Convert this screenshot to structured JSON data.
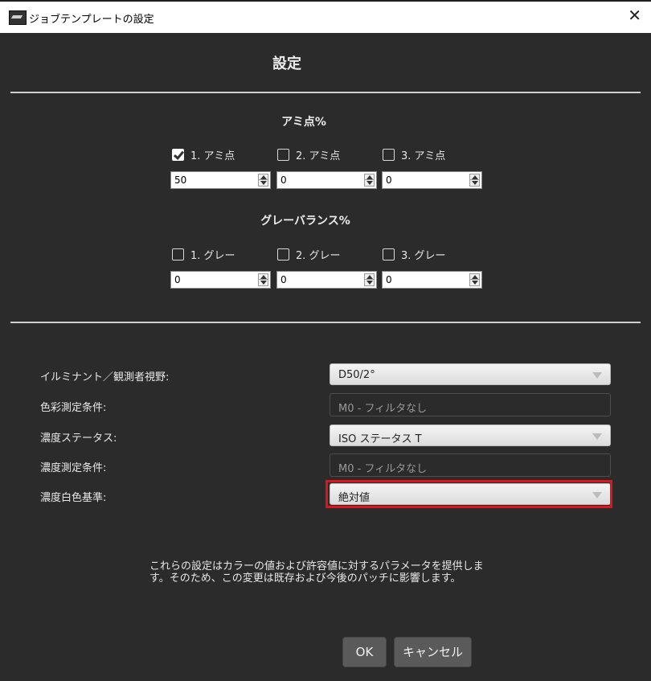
{
  "window": {
    "title": "ジョブテンプレートの設定",
    "close_glyph": "✕"
  },
  "main": {
    "title": "設定"
  },
  "ami": {
    "heading": "アミ点%",
    "items": [
      {
        "label": "1. アミ点",
        "checked": true,
        "value": "50"
      },
      {
        "label": "2. アミ点",
        "checked": false,
        "value": "0"
      },
      {
        "label": "3. アミ点",
        "checked": false,
        "value": "0"
      }
    ]
  },
  "gray": {
    "heading": "グレーバランス%",
    "items": [
      {
        "label": "1. グレー",
        "checked": false,
        "value": "0"
      },
      {
        "label": "2. グレー",
        "checked": false,
        "value": "0"
      },
      {
        "label": "3. グレー",
        "checked": false,
        "value": "0"
      }
    ]
  },
  "form": {
    "illuminant": {
      "label": "イルミナント／観測者視野:",
      "value": "D50/2°"
    },
    "color_condition": {
      "label": "色彩測定条件:",
      "value": "M0 - フィルタなし"
    },
    "density_status": {
      "label": "濃度ステータス:",
      "value": "ISO ステータス T"
    },
    "density_condition": {
      "label": "濃度測定条件:",
      "value": "M0 - フィルタなし"
    },
    "density_white": {
      "label": "濃度白色基準:",
      "value": "絶対値"
    }
  },
  "info": {
    "line1": "これらの設定はカラーの値および許容値に対するパラメータを提供しま",
    "line2": "す。そのため、この変更は既存および今後のパッチに影響します。"
  },
  "buttons": {
    "ok": "OK",
    "cancel": "キャンセル"
  },
  "colors": {
    "background": "#2b2b2b",
    "highlight": "#e0141e"
  }
}
